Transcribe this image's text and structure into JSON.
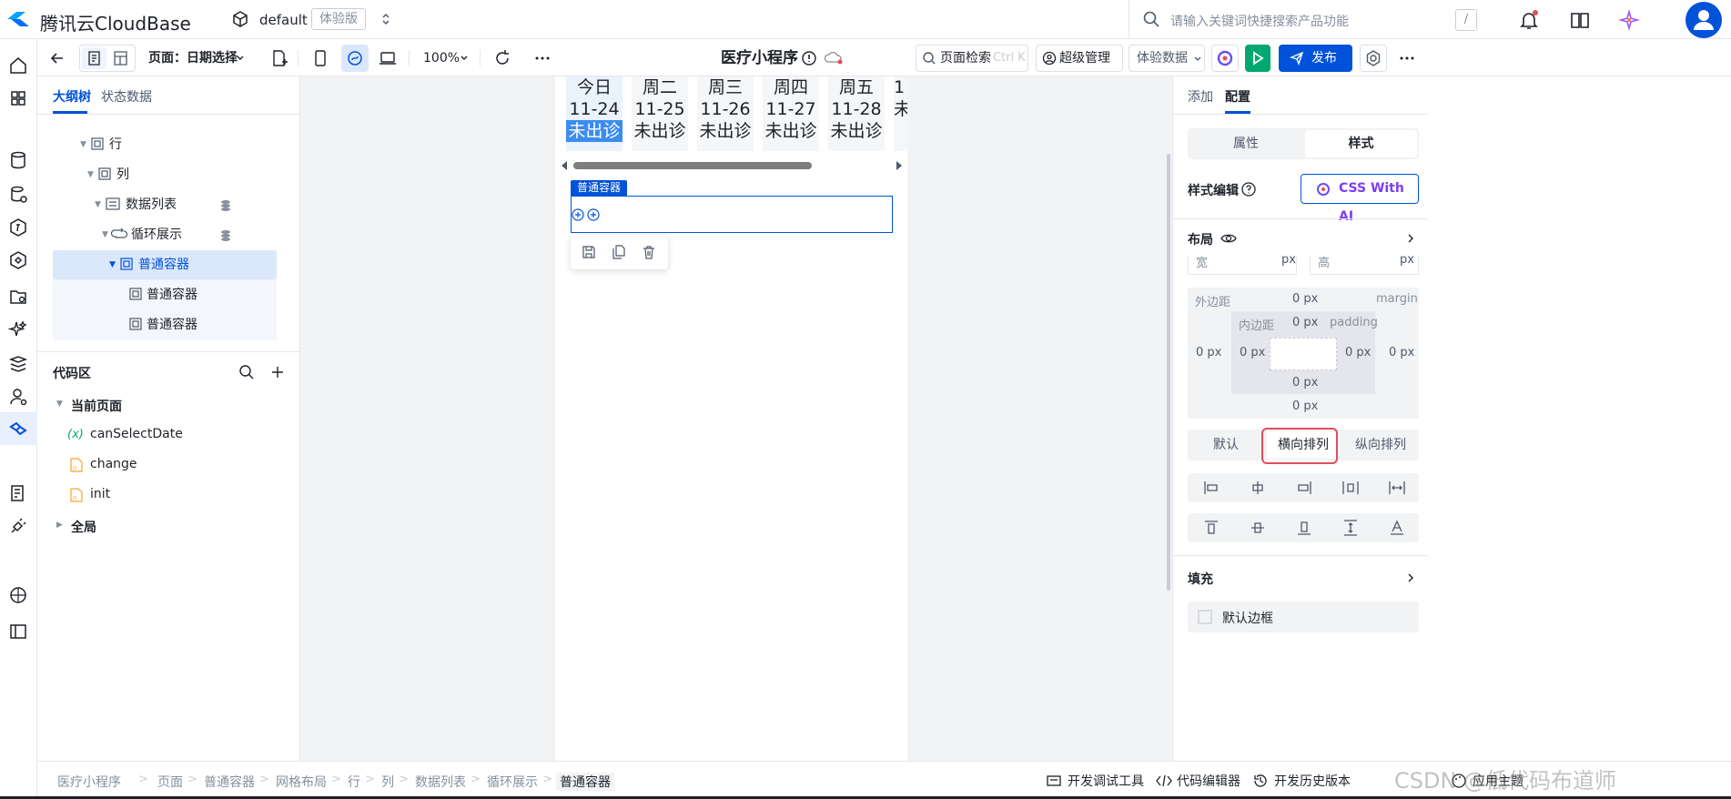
{
  "topbar": {
    "brand": "腾讯云CloudBase",
    "env_name": "default",
    "env_badge": "体验版",
    "search_placeholder": "请输入关键词快捷搜索产品功能",
    "search_shortcut": "/"
  },
  "toolbar": {
    "page_label": "页面：日期选择",
    "zoom": "100%",
    "app_title": "医疗小程序",
    "page_search": "页面检索",
    "page_search_shortcut": "Ctrl K",
    "role": "超级管理员",
    "data_source": "体验数据",
    "publish": "发布"
  },
  "left_panel": {
    "tabs": [
      "大纲树",
      "状态数据"
    ],
    "tree": [
      {
        "label": "行"
      },
      {
        "label": "列"
      },
      {
        "label": "数据列表"
      },
      {
        "label": "循环展示"
      },
      {
        "label": "普通容器"
      },
      {
        "label": "普通容器"
      },
      {
        "label": "普通容器"
      }
    ],
    "code_section_title": "代码区",
    "current_page": "当前页面",
    "code_items": [
      {
        "label": "canSelectDate",
        "kind": "variable",
        "prefix": "(x)"
      },
      {
        "label": "change",
        "kind": "js"
      },
      {
        "label": "init",
        "kind": "js"
      }
    ],
    "global": "全局"
  },
  "canvas": {
    "dates": [
      {
        "weekday": "今日",
        "date": "11-24",
        "status": "未出诊",
        "selected": true
      },
      {
        "weekday": "周二",
        "date": "11-25",
        "status": "未出诊",
        "selected": false
      },
      {
        "weekday": "周三",
        "date": "11-26",
        "status": "未出诊",
        "selected": false
      },
      {
        "weekday": "周四",
        "date": "11-27",
        "status": "未出诊",
        "selected": false
      },
      {
        "weekday": "周五",
        "date": "11-28",
        "status": "未出诊",
        "selected": false
      },
      {
        "weekday": "",
        "date": "1",
        "status": "未",
        "selected": false
      }
    ],
    "container_tag": "普通容器"
  },
  "right_panel": {
    "tabs": [
      "添加",
      "配置"
    ],
    "seg": [
      "属性",
      "样式"
    ],
    "style_edit": "样式编辑",
    "css_ai": "CSS With AI",
    "layout": "布局",
    "width_label": "宽",
    "height_label": "高",
    "unit": "px",
    "margin_label": "外边距",
    "margin_en": "margin",
    "padding_label": "内边距",
    "padding_en": "padding",
    "margin_top": "0 px",
    "margin_left": "0 px",
    "margin_right": "0 px",
    "margin_bottom": "0 px",
    "padding_top": "0 px",
    "padding_left": "0 px",
    "padding_right": "0 px",
    "padding_bottom": "0 px",
    "direction": [
      "默认",
      "横向排列",
      "纵向排列"
    ],
    "fill": "填充",
    "default_border": "默认边框"
  },
  "statusbar": {
    "breadcrumbs": [
      "医疗小程序",
      "页面",
      "普通容器",
      "网格布局",
      "行",
      "列",
      "数据列表",
      "循环展示",
      "普通容器"
    ],
    "debug": "开发调试工具",
    "code_editor": "代码编辑器",
    "history": "开发历史版本",
    "apply_theme": "应用主题"
  },
  "watermark": "CSDN @低代码布道师",
  "colors": {
    "primary": "#0052d9",
    "highlight": "#e34d59",
    "selected_bg": "#dbe7fb"
  }
}
